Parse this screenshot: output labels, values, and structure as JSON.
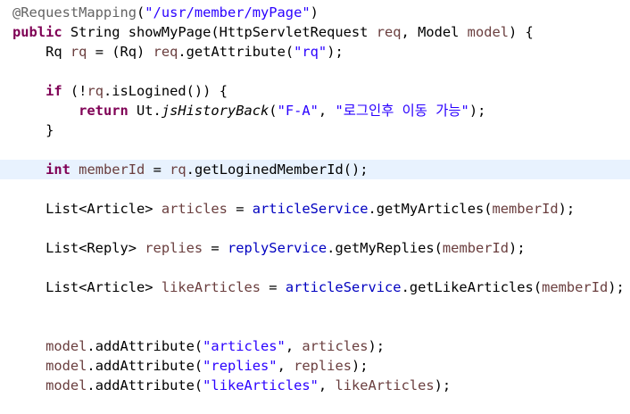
{
  "colors": {
    "keyword": "#7f0055",
    "string": "#2a00ff",
    "local_variable": "#6a3e3e",
    "field": "#0000c0",
    "annotation": "#646464",
    "plain": "#000000",
    "current_line": "#e8f2fe"
  },
  "editor": {
    "lines": [
      {
        "indent": "",
        "current": false,
        "tokens": [
          {
            "text": "@RequestMapping",
            "kind": "ann"
          },
          {
            "text": "(",
            "kind": "plain"
          },
          {
            "text": "\"/usr/member/myPage\"",
            "kind": "str"
          },
          {
            "text": ")",
            "kind": "plain"
          }
        ]
      },
      {
        "indent": "",
        "current": false,
        "tokens": [
          {
            "text": "public",
            "kind": "kw"
          },
          {
            "text": " String showMyPage(HttpServletRequest ",
            "kind": "plain"
          },
          {
            "text": "req",
            "kind": "var"
          },
          {
            "text": ", Model ",
            "kind": "plain"
          },
          {
            "text": "model",
            "kind": "var"
          },
          {
            "text": ") {",
            "kind": "plain"
          }
        ]
      },
      {
        "indent": "    ",
        "current": false,
        "tokens": [
          {
            "text": "Rq ",
            "kind": "plain"
          },
          {
            "text": "rq",
            "kind": "var"
          },
          {
            "text": " = (Rq) ",
            "kind": "plain"
          },
          {
            "text": "req",
            "kind": "var"
          },
          {
            "text": ".getAttribute(",
            "kind": "plain"
          },
          {
            "text": "\"rq\"",
            "kind": "str"
          },
          {
            "text": ");",
            "kind": "plain"
          }
        ]
      },
      {
        "indent": "",
        "current": false,
        "tokens": []
      },
      {
        "indent": "    ",
        "current": false,
        "tokens": [
          {
            "text": "if",
            "kind": "kw"
          },
          {
            "text": " (!",
            "kind": "plain"
          },
          {
            "text": "rq",
            "kind": "var"
          },
          {
            "text": ".isLogined()) {",
            "kind": "plain"
          }
        ]
      },
      {
        "indent": "        ",
        "current": false,
        "tokens": [
          {
            "text": "return",
            "kind": "kw"
          },
          {
            "text": " Ut.",
            "kind": "plain"
          },
          {
            "text": "jsHistoryBack",
            "kind": "italic"
          },
          {
            "text": "(",
            "kind": "plain"
          },
          {
            "text": "\"F-A\"",
            "kind": "str"
          },
          {
            "text": ", ",
            "kind": "plain"
          },
          {
            "text": "\"로그인후 이동 가능\"",
            "kind": "str"
          },
          {
            "text": ");",
            "kind": "plain"
          }
        ]
      },
      {
        "indent": "    ",
        "current": false,
        "tokens": [
          {
            "text": "}",
            "kind": "plain"
          }
        ]
      },
      {
        "indent": "",
        "current": false,
        "tokens": []
      },
      {
        "indent": "    ",
        "current": true,
        "tokens": [
          {
            "text": "int",
            "kind": "kw"
          },
          {
            "text": " ",
            "kind": "plain"
          },
          {
            "text": "memberId",
            "kind": "var"
          },
          {
            "text": " = ",
            "kind": "plain"
          },
          {
            "text": "rq",
            "kind": "var"
          },
          {
            "text": ".getLoginedMemberId();",
            "kind": "plain"
          }
        ]
      },
      {
        "indent": "",
        "current": false,
        "tokens": []
      },
      {
        "indent": "    ",
        "current": false,
        "tokens": [
          {
            "text": "List<Article> ",
            "kind": "plain"
          },
          {
            "text": "articles",
            "kind": "var"
          },
          {
            "text": " = ",
            "kind": "plain"
          },
          {
            "text": "articleService",
            "kind": "field"
          },
          {
            "text": ".getMyArticles(",
            "kind": "plain"
          },
          {
            "text": "memberId",
            "kind": "var"
          },
          {
            "text": ");",
            "kind": "plain"
          }
        ]
      },
      {
        "indent": "",
        "current": false,
        "tokens": []
      },
      {
        "indent": "    ",
        "current": false,
        "tokens": [
          {
            "text": "List<Reply> ",
            "kind": "plain"
          },
          {
            "text": "replies",
            "kind": "var"
          },
          {
            "text": " = ",
            "kind": "plain"
          },
          {
            "text": "replyService",
            "kind": "field"
          },
          {
            "text": ".getMyReplies(",
            "kind": "plain"
          },
          {
            "text": "memberId",
            "kind": "var"
          },
          {
            "text": ");",
            "kind": "plain"
          }
        ]
      },
      {
        "indent": "",
        "current": false,
        "tokens": []
      },
      {
        "indent": "    ",
        "current": false,
        "tokens": [
          {
            "text": "List<Article> ",
            "kind": "plain"
          },
          {
            "text": "likeArticles",
            "kind": "var"
          },
          {
            "text": " = ",
            "kind": "plain"
          },
          {
            "text": "articleService",
            "kind": "field"
          },
          {
            "text": ".getLikeArticles(",
            "kind": "plain"
          },
          {
            "text": "memberId",
            "kind": "var"
          },
          {
            "text": ");",
            "kind": "plain"
          }
        ]
      },
      {
        "indent": "",
        "current": false,
        "tokens": []
      },
      {
        "indent": "",
        "current": false,
        "tokens": []
      },
      {
        "indent": "    ",
        "current": false,
        "tokens": [
          {
            "text": "model",
            "kind": "var"
          },
          {
            "text": ".addAttribute(",
            "kind": "plain"
          },
          {
            "text": "\"articles\"",
            "kind": "str"
          },
          {
            "text": ", ",
            "kind": "plain"
          },
          {
            "text": "articles",
            "kind": "var"
          },
          {
            "text": ");",
            "kind": "plain"
          }
        ]
      },
      {
        "indent": "    ",
        "current": false,
        "tokens": [
          {
            "text": "model",
            "kind": "var"
          },
          {
            "text": ".addAttribute(",
            "kind": "plain"
          },
          {
            "text": "\"replies\"",
            "kind": "str"
          },
          {
            "text": ", ",
            "kind": "plain"
          },
          {
            "text": "replies",
            "kind": "var"
          },
          {
            "text": ");",
            "kind": "plain"
          }
        ]
      },
      {
        "indent": "    ",
        "current": false,
        "tokens": [
          {
            "text": "model",
            "kind": "var"
          },
          {
            "text": ".addAttribute(",
            "kind": "plain"
          },
          {
            "text": "\"likeArticles\"",
            "kind": "str"
          },
          {
            "text": ", ",
            "kind": "plain"
          },
          {
            "text": "likeArticles",
            "kind": "var"
          },
          {
            "text": ");",
            "kind": "plain"
          }
        ]
      }
    ]
  }
}
